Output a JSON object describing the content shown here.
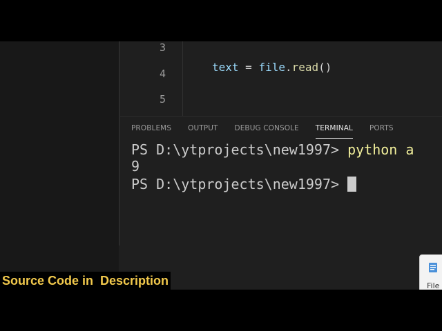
{
  "editor": {
    "lines": [
      {
        "number": "3",
        "code": ""
      },
      {
        "number": "4",
        "code": "text = file.read()"
      },
      {
        "number": "5",
        "code": ""
      }
    ],
    "code_tokens": {
      "var": "text",
      "eq": " = ",
      "obj": "file",
      "dot": ".",
      "fn": "read",
      "parens": "()"
    }
  },
  "panel": {
    "tabs": [
      {
        "label": "PROBLEMS",
        "active": false
      },
      {
        "label": "OUTPUT",
        "active": false
      },
      {
        "label": "DEBUG CONSOLE",
        "active": false
      },
      {
        "label": "TERMINAL",
        "active": true
      },
      {
        "label": "PORTS",
        "active": false
      }
    ]
  },
  "terminal": {
    "prompt1": "PS D:\\ytprojects\\new1997> ",
    "command1": "python a",
    "output1": "9",
    "prompt2": "PS D:\\ytprojects\\new1997> "
  },
  "caption": {
    "text": "Source Code in  Description",
    "color": "#f2c94c"
  },
  "file_popup": {
    "label": "File",
    "icon": "file-icon"
  },
  "colors": {
    "editor_bg": "#1f1f1f",
    "sidebar_bg": "#181818",
    "accent_active_tab": "#e7e7e7"
  }
}
